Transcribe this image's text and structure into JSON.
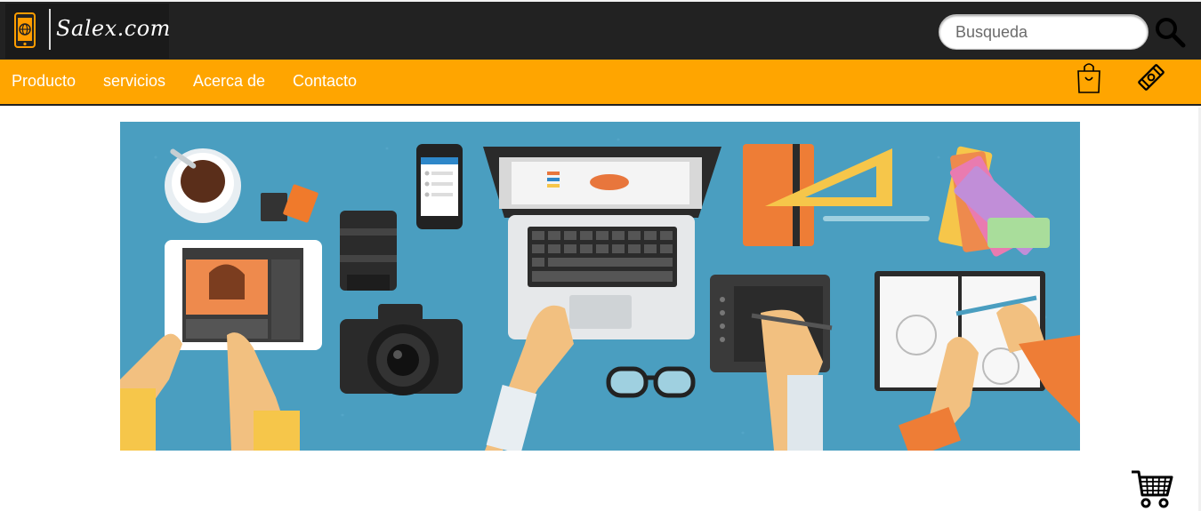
{
  "brand": {
    "name": "Salex.com",
    "logo_icon": "phone-globe-icon"
  },
  "search": {
    "placeholder": "Busqueda",
    "value": "",
    "icon": "search-icon"
  },
  "nav": {
    "items": [
      {
        "label": "Producto"
      },
      {
        "label": "servicios"
      },
      {
        "label": "Acerca de"
      },
      {
        "label": "Contacto"
      }
    ],
    "icons": [
      "shopping-bag-icon",
      "tag-icon"
    ]
  },
  "hero": {
    "image": "workspace-illustration"
  },
  "cart": {
    "icon": "shopping-cart-icon"
  },
  "colors": {
    "header_bg": "#222222",
    "nav_bg": "#ffa500",
    "nav_text": "#ffffff",
    "hero_bg": "#4a9ec0"
  }
}
